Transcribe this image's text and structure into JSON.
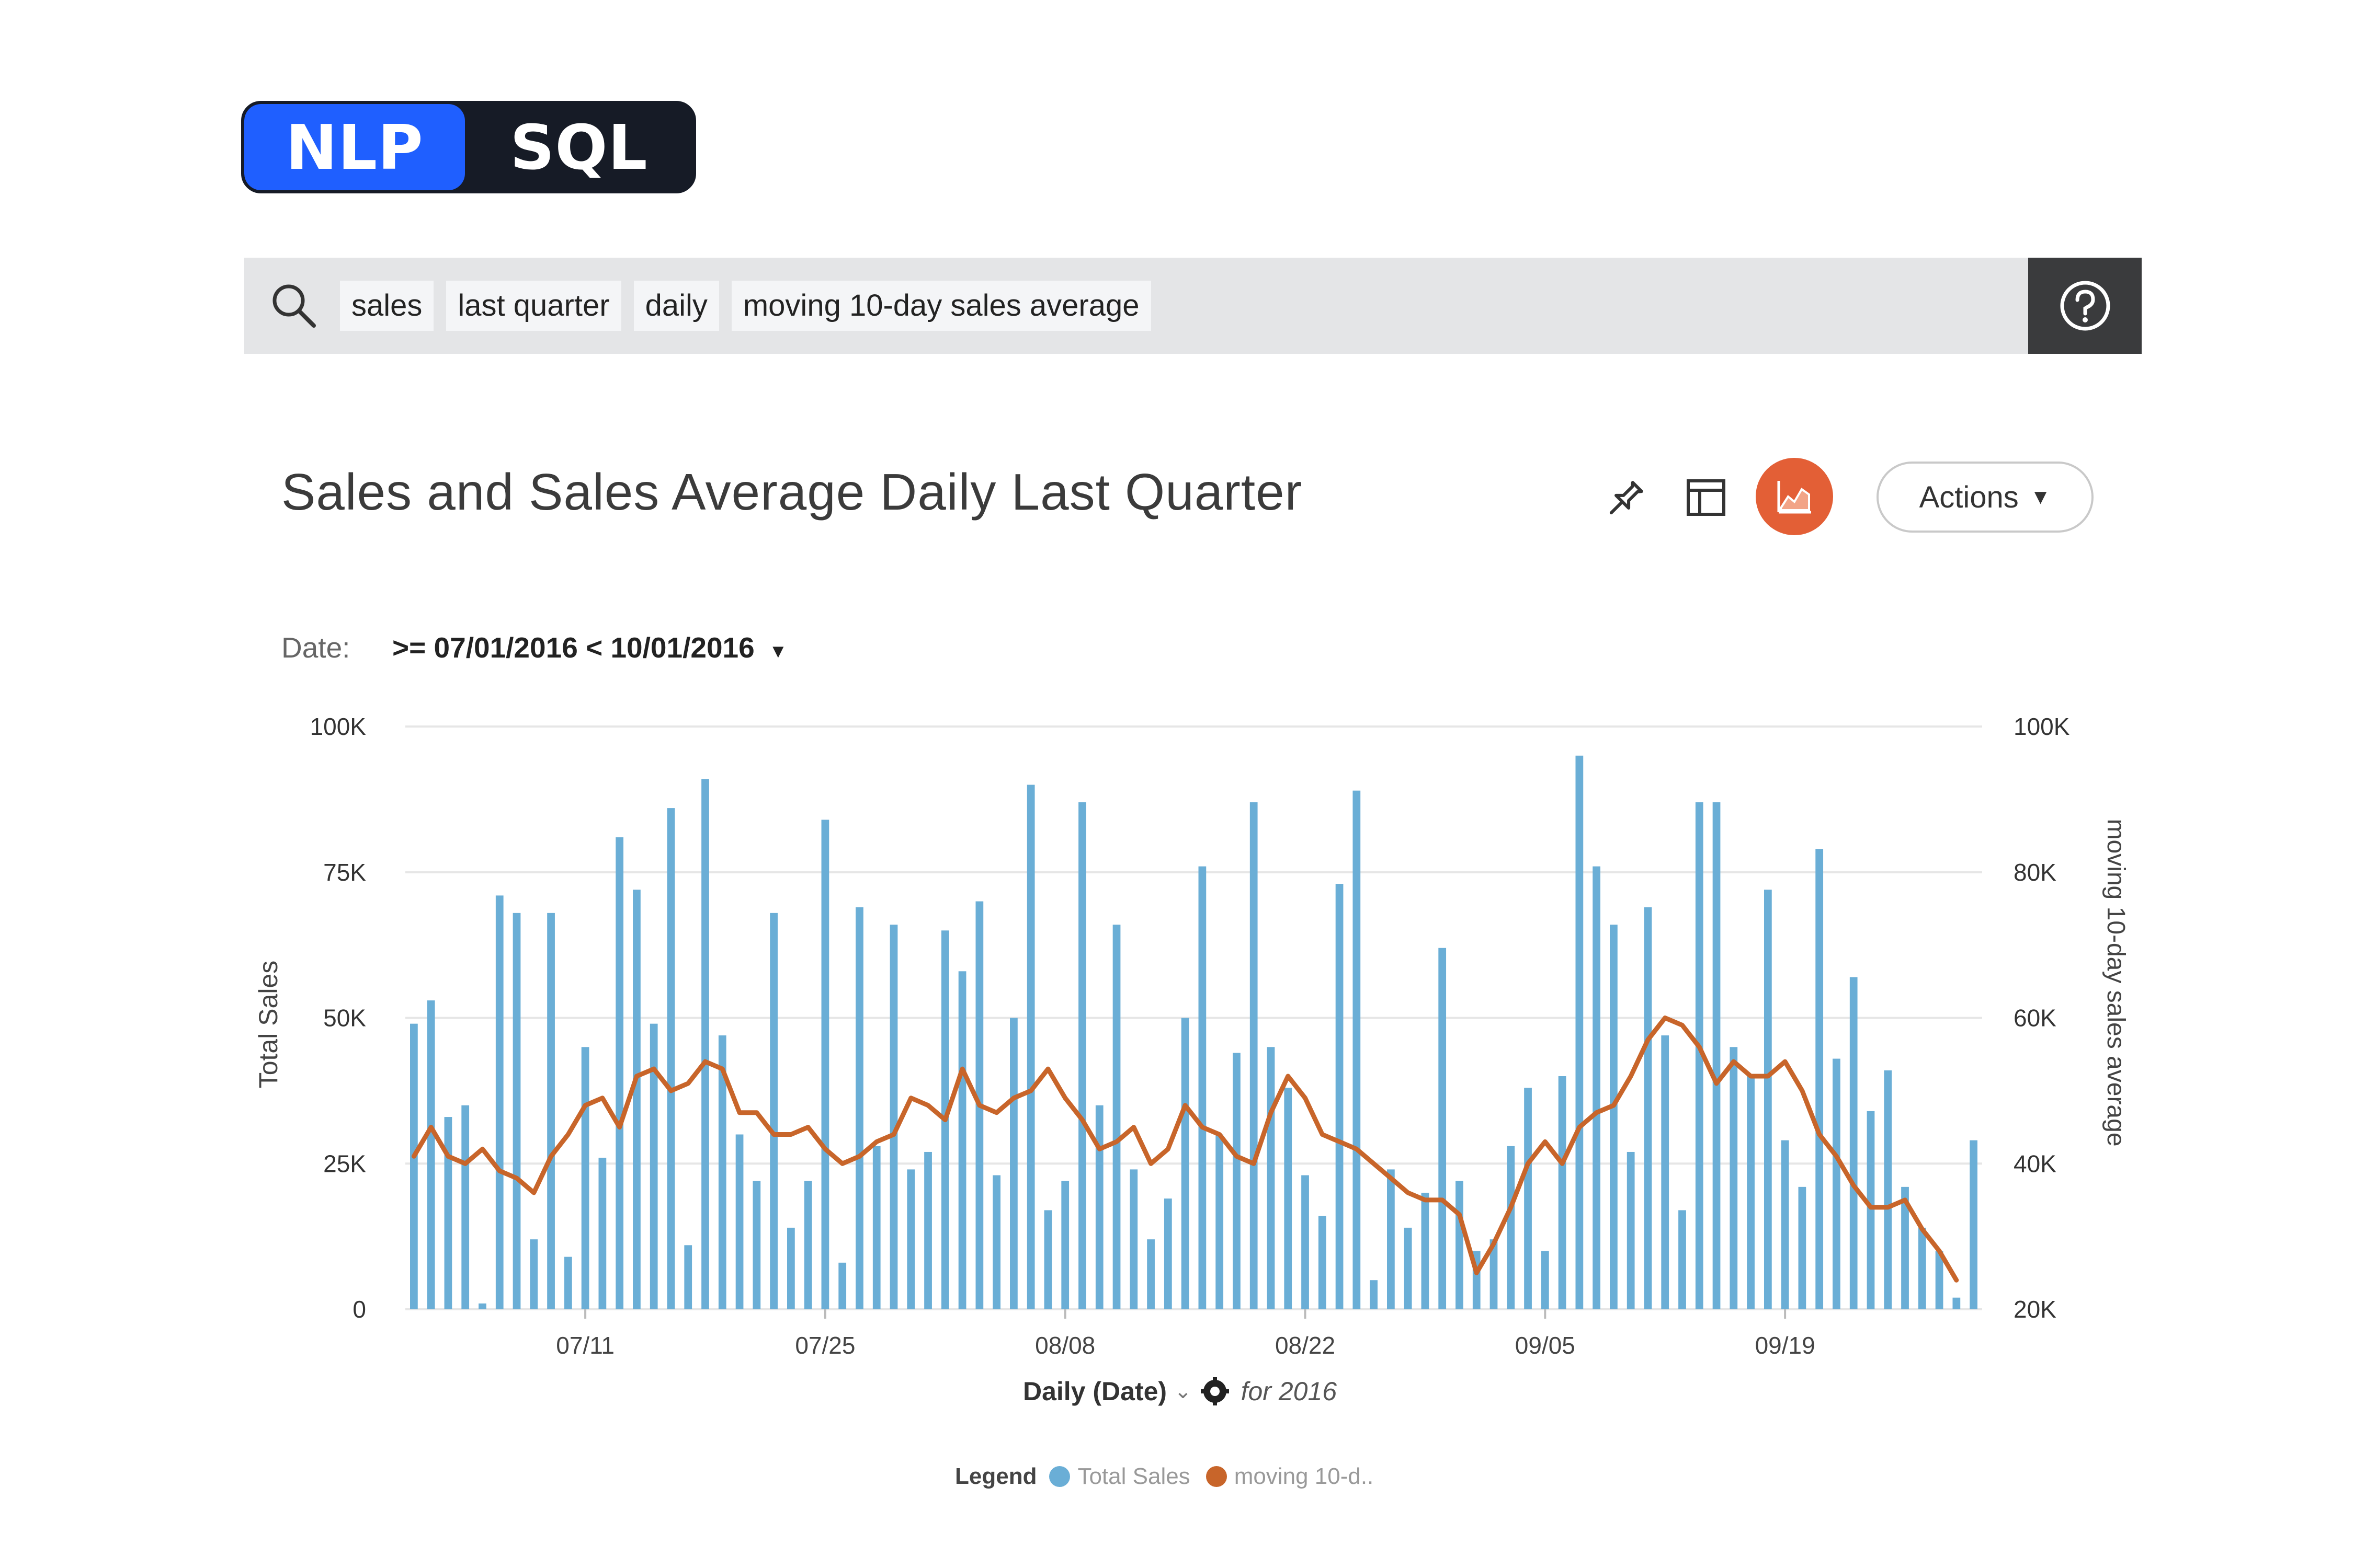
{
  "mode_toggle": {
    "nlp_label": "NLP",
    "sql_label": "SQL",
    "active": "NLP"
  },
  "search": {
    "tokens": [
      "sales",
      "last quarter",
      "daily",
      "moving 10-day sales average"
    ]
  },
  "header": {
    "title": "Sales and Sales Average Daily Last Quarter",
    "actions_label": "Actions",
    "chart_button_color": "#e35f36"
  },
  "filter": {
    "label": "Date:",
    "value": ">= 07/01/2016 < 10/01/2016"
  },
  "x_axis_row": {
    "label": "Daily (Date)",
    "suffix": "for 2016"
  },
  "legend": {
    "title": "Legend",
    "items": [
      "Total Sales",
      "moving 10-d.."
    ]
  },
  "colors": {
    "bar": "#6aaed6",
    "line": "#c8652a",
    "accent_blue": "#1f5fff"
  },
  "chart_data": {
    "type": "bar",
    "title": "Sales and Sales Average Daily Last Quarter",
    "xlabel": "Daily (Date)",
    "ylabel": "Total Sales",
    "y2label": "moving 10-day sales average",
    "x_tick_labels": [
      "07/11",
      "07/25",
      "08/08",
      "08/22",
      "09/05",
      "09/19"
    ],
    "x_tick_indices": [
      10,
      24,
      38,
      52,
      66,
      80
    ],
    "y_ticks": [
      "0",
      "25K",
      "50K",
      "75K",
      "100K"
    ],
    "y2_ticks": [
      "20K",
      "40K",
      "60K",
      "80K",
      "100K"
    ],
    "ylim": [
      0,
      100000
    ],
    "y2lim": [
      20000,
      100000
    ],
    "grid": true,
    "legend_position": "bottom",
    "series": [
      {
        "name": "Total Sales",
        "type": "bar",
        "axis": "left",
        "values": [
          49000,
          53000,
          33000,
          35000,
          1000,
          71000,
          68000,
          12000,
          68000,
          9000,
          45000,
          26000,
          81000,
          72000,
          49000,
          86000,
          11000,
          91000,
          47000,
          30000,
          22000,
          68000,
          14000,
          22000,
          84000,
          8000,
          69000,
          28000,
          66000,
          24000,
          27000,
          65000,
          58000,
          70000,
          23000,
          50000,
          90000,
          17000,
          22000,
          87000,
          35000,
          66000,
          24000,
          12000,
          19000,
          50000,
          76000,
          30000,
          44000,
          87000,
          45000,
          38000,
          23000,
          16000,
          73000,
          89000,
          5000,
          24000,
          14000,
          20000,
          62000,
          22000,
          10000,
          12000,
          28000,
          38000,
          10000,
          40000,
          95000,
          76000,
          66000,
          27000,
          69000,
          47000,
          17000,
          87000,
          87000,
          45000,
          40000,
          72000,
          29000,
          21000,
          79000,
          43000,
          57000,
          34000,
          41000,
          21000,
          14000,
          10000,
          2000,
          29000
        ]
      },
      {
        "name": "moving 10-day sales average",
        "type": "line",
        "axis": "right",
        "values": [
          41000,
          45000,
          41000,
          40000,
          42000,
          39000,
          38000,
          36000,
          41000,
          44000,
          48000,
          49000,
          45000,
          52000,
          53000,
          50000,
          51000,
          54000,
          53000,
          47000,
          47000,
          44000,
          44000,
          45000,
          42000,
          40000,
          41000,
          43000,
          44000,
          49000,
          48000,
          46000,
          53000,
          48000,
          47000,
          49000,
          50000,
          53000,
          49000,
          46000,
          42000,
          43000,
          45000,
          40000,
          42000,
          48000,
          45000,
          44000,
          41000,
          40000,
          47000,
          52000,
          49000,
          44000,
          43000,
          42000,
          40000,
          38000,
          36000,
          35000,
          35000,
          33000,
          25000,
          29000,
          34000,
          40000,
          43000,
          40000,
          45000,
          47000,
          48000,
          52000,
          57000,
          60000,
          59000,
          56000,
          51000,
          54000,
          52000,
          52000,
          54000,
          50000,
          44000,
          41000,
          37000,
          34000,
          34000,
          35000,
          31000,
          28000,
          24000
        ]
      }
    ]
  }
}
